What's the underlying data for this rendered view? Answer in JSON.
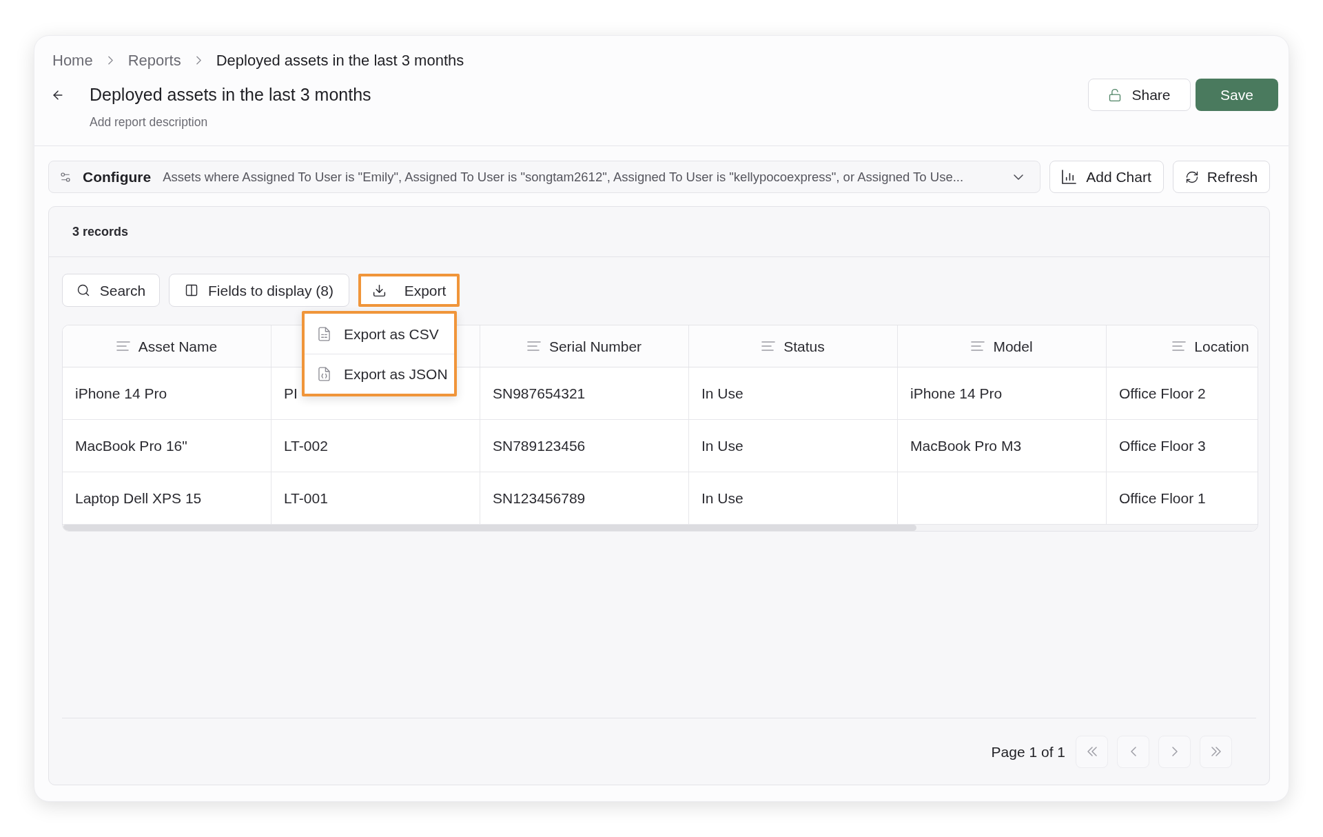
{
  "breadcrumb": [
    {
      "label": "Home",
      "current": false
    },
    {
      "label": "Reports",
      "current": false
    },
    {
      "label": "Deployed assets in the last 3 months",
      "current": true
    }
  ],
  "header": {
    "title": "Deployed assets in the last 3 months",
    "description": "Add report description",
    "actions": [
      {
        "kind": "share",
        "label": "Share"
      },
      {
        "kind": "save",
        "label": "Save"
      }
    ]
  },
  "configure": {
    "label": "Configure",
    "filter": "Assets where Assigned To User is \"Emily\", Assigned To User is \"songtam2612\", Assigned To User is \"kellypocoexpress\", or Assigned To Use..."
  },
  "actions": [
    {
      "kind": "chart",
      "label": "Add Chart"
    },
    {
      "kind": "refresh",
      "label": "Refresh"
    }
  ],
  "records": {
    "count": "3 records"
  },
  "toolbar": [
    {
      "kind": "search",
      "label": "Search",
      "highlighted": false
    },
    {
      "kind": "fields",
      "label": "Fields to display (8)",
      "highlighted": false
    },
    {
      "kind": "export",
      "label": "Export",
      "highlighted": true
    }
  ],
  "export_menu": {
    "highlighted": true,
    "items": [
      {
        "kind": "csv",
        "label": "Export as CSV"
      },
      {
        "kind": "json",
        "label": "Export as JSON"
      }
    ]
  },
  "table": {
    "columns": [
      {
        "label": "Asset Name"
      },
      {},
      {
        "label": "Serial Number"
      },
      {
        "label": "Status"
      },
      {
        "label": "Model"
      },
      {
        "label": "Location"
      }
    ],
    "rows": [
      {
        "cells": [
          "iPhone 14 Pro",
          "PI",
          "SN987654321",
          "In Use",
          "iPhone 14 Pro",
          "Office Floor 2"
        ]
      },
      {
        "cells": [
          "MacBook Pro 16\"",
          "LT-002",
          "SN789123456",
          "In Use",
          "MacBook Pro M3",
          "Office Floor 3"
        ]
      },
      {
        "cells": [
          "Laptop Dell XPS 15",
          "LT-001",
          "SN123456789",
          "In Use",
          null,
          "Office Floor 1"
        ]
      }
    ]
  },
  "pagination": {
    "label": "Page 1 of 1",
    "buttons": [
      {
        "kind": "first",
        "disabled": true
      },
      {
        "kind": "previous",
        "disabled": true
      },
      {
        "kind": "next",
        "disabled": true
      },
      {
        "kind": "last",
        "disabled": true
      }
    ]
  }
}
